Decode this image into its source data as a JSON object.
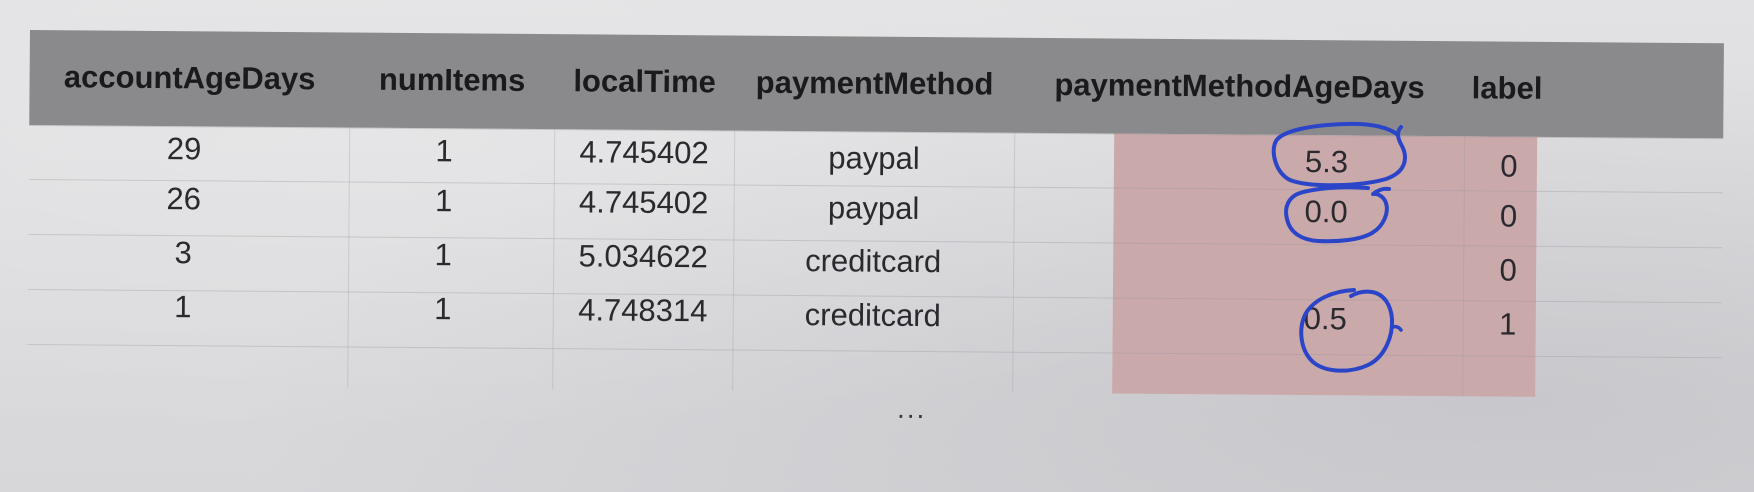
{
  "table": {
    "columns": [
      "accountAgeDays",
      "numItems",
      "localTime",
      "paymentMethod",
      "paymentMethodAgeDays",
      "label"
    ],
    "rows": [
      [
        "29",
        "1",
        "4.745402",
        "paypal",
        "5.3",
        "0"
      ],
      [
        "26",
        "1",
        "4.745402",
        "paypal",
        "0.0",
        "0"
      ],
      [
        "3",
        "1",
        "5.034622",
        "creditcard",
        "",
        "0"
      ],
      [
        "1",
        "1",
        "4.748314",
        "creditcard",
        "0.5",
        "1"
      ]
    ],
    "ellipsis": "...",
    "highlighted_column": "paymentMethodAgeDays"
  },
  "colors": {
    "header_bg": "#8a8a8d",
    "highlight_bg": "#caa9ab",
    "ink_pen": "#2b45c8"
  }
}
